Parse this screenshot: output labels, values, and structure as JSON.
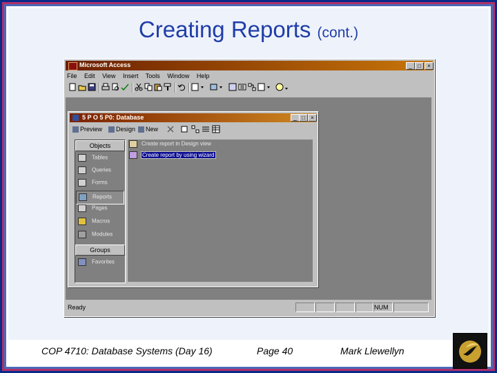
{
  "slide": {
    "title": "Creating Reports",
    "title_suffix": "(cont.)"
  },
  "access": {
    "window_title": "Microsoft Access",
    "controls": {
      "minimize": "_",
      "maximize": "□",
      "close": "×"
    },
    "menu": [
      "File",
      "Edit",
      "View",
      "Insert",
      "Tools",
      "Window",
      "Help"
    ],
    "status_left": "Ready",
    "status_num": "NUM"
  },
  "db": {
    "window_title": "5 P O 5 P0: Database",
    "toolbar": {
      "preview": "Preview",
      "design": "Design",
      "new": "New"
    },
    "objects_header": "Objects",
    "objects": [
      "Tables",
      "Queries",
      "Forms",
      "Reports",
      "Pages",
      "Macros",
      "Modules"
    ],
    "groups_header": "Groups",
    "groups": [
      "Favorites"
    ],
    "list": [
      "Create report in Design view",
      "Create report by using wizard"
    ]
  },
  "footer": {
    "course": "COP 4710: Database Systems  (Day 16)",
    "page": "Page 40",
    "author": "Mark Llewellyn"
  },
  "colors": {
    "title_blue": "#1f3ea8",
    "titlebar_start": "#6b1f00",
    "titlebar_end": "#c8760a",
    "selection": "#0a0a90"
  }
}
